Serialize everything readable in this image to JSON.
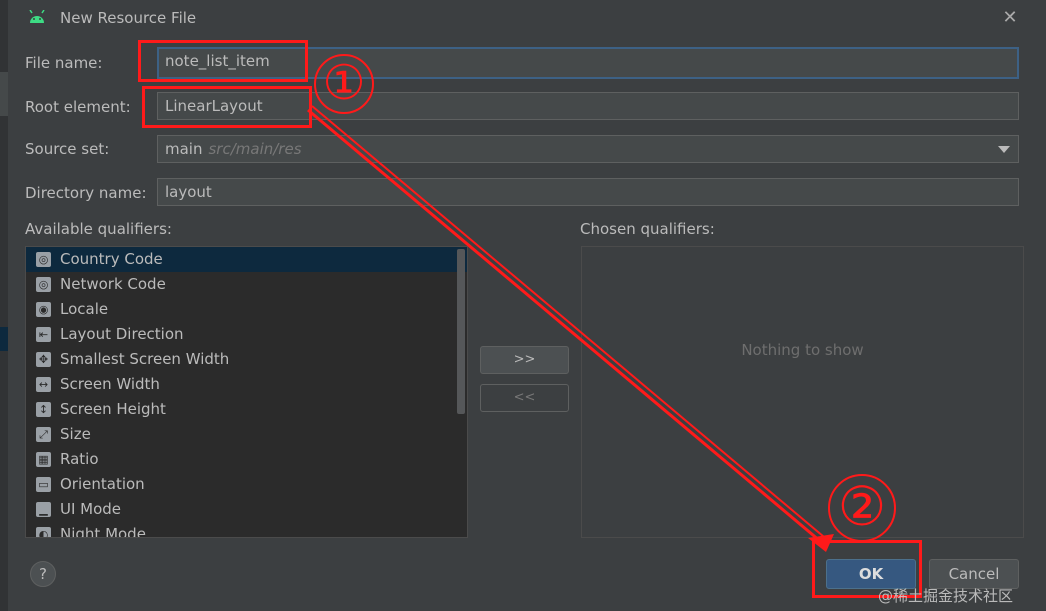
{
  "window": {
    "title": "New Resource File",
    "icon": "android-icon"
  },
  "form": {
    "file_name_label": "File name:",
    "file_name_value": "note_list_item",
    "root_element_label": "Root element:",
    "root_element_value": "LinearLayout",
    "source_set_label": "Source set:",
    "source_set_value": "main",
    "source_set_hint": "src/main/res",
    "directory_name_label": "Directory name:",
    "directory_name_value": "layout"
  },
  "qualifiers": {
    "available_label": "Available qualifiers:",
    "chosen_label": "Chosen qualifiers:",
    "empty_text": "Nothing to show",
    "add_button": ">>",
    "remove_button": "<<",
    "items": [
      {
        "label": "Country Code",
        "icon": "country-code-icon",
        "selected": true
      },
      {
        "label": "Network Code",
        "icon": "network-code-icon"
      },
      {
        "label": "Locale",
        "icon": "locale-icon"
      },
      {
        "label": "Layout Direction",
        "icon": "layout-direction-icon"
      },
      {
        "label": "Smallest Screen Width",
        "icon": "smallest-screen-width-icon"
      },
      {
        "label": "Screen Width",
        "icon": "screen-width-icon"
      },
      {
        "label": "Screen Height",
        "icon": "screen-height-icon"
      },
      {
        "label": "Size",
        "icon": "size-icon"
      },
      {
        "label": "Ratio",
        "icon": "ratio-icon"
      },
      {
        "label": "Orientation",
        "icon": "orientation-icon"
      },
      {
        "label": "UI Mode",
        "icon": "ui-mode-icon"
      },
      {
        "label": "Night Mode",
        "icon": "night-mode-icon"
      }
    ]
  },
  "buttons": {
    "help": "?",
    "ok": "OK",
    "cancel": "Cancel"
  },
  "annotations": {
    "marker_1": "①",
    "marker_2": "②"
  },
  "watermark": "@稀土掘金技术社区",
  "colors": {
    "accent": "#365880",
    "annotation": "#ff1a1a",
    "selection": "#0d293e"
  }
}
